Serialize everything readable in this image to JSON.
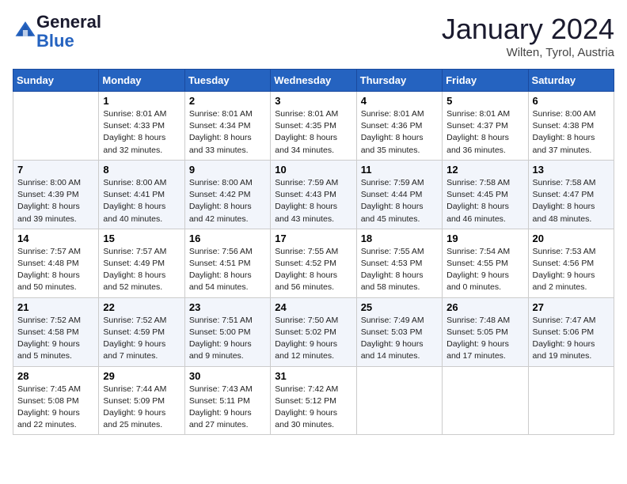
{
  "header": {
    "logo_line1": "General",
    "logo_line2": "Blue",
    "month_title": "January 2024",
    "location": "Wilten, Tyrol, Austria"
  },
  "weekdays": [
    "Sunday",
    "Monday",
    "Tuesday",
    "Wednesday",
    "Thursday",
    "Friday",
    "Saturday"
  ],
  "weeks": [
    [
      {
        "day": "",
        "sunrise": "",
        "sunset": "",
        "daylight": ""
      },
      {
        "day": "1",
        "sunrise": "Sunrise: 8:01 AM",
        "sunset": "Sunset: 4:33 PM",
        "daylight": "Daylight: 8 hours and 32 minutes."
      },
      {
        "day": "2",
        "sunrise": "Sunrise: 8:01 AM",
        "sunset": "Sunset: 4:34 PM",
        "daylight": "Daylight: 8 hours and 33 minutes."
      },
      {
        "day": "3",
        "sunrise": "Sunrise: 8:01 AM",
        "sunset": "Sunset: 4:35 PM",
        "daylight": "Daylight: 8 hours and 34 minutes."
      },
      {
        "day": "4",
        "sunrise": "Sunrise: 8:01 AM",
        "sunset": "Sunset: 4:36 PM",
        "daylight": "Daylight: 8 hours and 35 minutes."
      },
      {
        "day": "5",
        "sunrise": "Sunrise: 8:01 AM",
        "sunset": "Sunset: 4:37 PM",
        "daylight": "Daylight: 8 hours and 36 minutes."
      },
      {
        "day": "6",
        "sunrise": "Sunrise: 8:00 AM",
        "sunset": "Sunset: 4:38 PM",
        "daylight": "Daylight: 8 hours and 37 minutes."
      }
    ],
    [
      {
        "day": "7",
        "sunrise": "Sunrise: 8:00 AM",
        "sunset": "Sunset: 4:39 PM",
        "daylight": "Daylight: 8 hours and 39 minutes."
      },
      {
        "day": "8",
        "sunrise": "Sunrise: 8:00 AM",
        "sunset": "Sunset: 4:41 PM",
        "daylight": "Daylight: 8 hours and 40 minutes."
      },
      {
        "day": "9",
        "sunrise": "Sunrise: 8:00 AM",
        "sunset": "Sunset: 4:42 PM",
        "daylight": "Daylight: 8 hours and 42 minutes."
      },
      {
        "day": "10",
        "sunrise": "Sunrise: 7:59 AM",
        "sunset": "Sunset: 4:43 PM",
        "daylight": "Daylight: 8 hours and 43 minutes."
      },
      {
        "day": "11",
        "sunrise": "Sunrise: 7:59 AM",
        "sunset": "Sunset: 4:44 PM",
        "daylight": "Daylight: 8 hours and 45 minutes."
      },
      {
        "day": "12",
        "sunrise": "Sunrise: 7:58 AM",
        "sunset": "Sunset: 4:45 PM",
        "daylight": "Daylight: 8 hours and 46 minutes."
      },
      {
        "day": "13",
        "sunrise": "Sunrise: 7:58 AM",
        "sunset": "Sunset: 4:47 PM",
        "daylight": "Daylight: 8 hours and 48 minutes."
      }
    ],
    [
      {
        "day": "14",
        "sunrise": "Sunrise: 7:57 AM",
        "sunset": "Sunset: 4:48 PM",
        "daylight": "Daylight: 8 hours and 50 minutes."
      },
      {
        "day": "15",
        "sunrise": "Sunrise: 7:57 AM",
        "sunset": "Sunset: 4:49 PM",
        "daylight": "Daylight: 8 hours and 52 minutes."
      },
      {
        "day": "16",
        "sunrise": "Sunrise: 7:56 AM",
        "sunset": "Sunset: 4:51 PM",
        "daylight": "Daylight: 8 hours and 54 minutes."
      },
      {
        "day": "17",
        "sunrise": "Sunrise: 7:55 AM",
        "sunset": "Sunset: 4:52 PM",
        "daylight": "Daylight: 8 hours and 56 minutes."
      },
      {
        "day": "18",
        "sunrise": "Sunrise: 7:55 AM",
        "sunset": "Sunset: 4:53 PM",
        "daylight": "Daylight: 8 hours and 58 minutes."
      },
      {
        "day": "19",
        "sunrise": "Sunrise: 7:54 AM",
        "sunset": "Sunset: 4:55 PM",
        "daylight": "Daylight: 9 hours and 0 minutes."
      },
      {
        "day": "20",
        "sunrise": "Sunrise: 7:53 AM",
        "sunset": "Sunset: 4:56 PM",
        "daylight": "Daylight: 9 hours and 2 minutes."
      }
    ],
    [
      {
        "day": "21",
        "sunrise": "Sunrise: 7:52 AM",
        "sunset": "Sunset: 4:58 PM",
        "daylight": "Daylight: 9 hours and 5 minutes."
      },
      {
        "day": "22",
        "sunrise": "Sunrise: 7:52 AM",
        "sunset": "Sunset: 4:59 PM",
        "daylight": "Daylight: 9 hours and 7 minutes."
      },
      {
        "day": "23",
        "sunrise": "Sunrise: 7:51 AM",
        "sunset": "Sunset: 5:00 PM",
        "daylight": "Daylight: 9 hours and 9 minutes."
      },
      {
        "day": "24",
        "sunrise": "Sunrise: 7:50 AM",
        "sunset": "Sunset: 5:02 PM",
        "daylight": "Daylight: 9 hours and 12 minutes."
      },
      {
        "day": "25",
        "sunrise": "Sunrise: 7:49 AM",
        "sunset": "Sunset: 5:03 PM",
        "daylight": "Daylight: 9 hours and 14 minutes."
      },
      {
        "day": "26",
        "sunrise": "Sunrise: 7:48 AM",
        "sunset": "Sunset: 5:05 PM",
        "daylight": "Daylight: 9 hours and 17 minutes."
      },
      {
        "day": "27",
        "sunrise": "Sunrise: 7:47 AM",
        "sunset": "Sunset: 5:06 PM",
        "daylight": "Daylight: 9 hours and 19 minutes."
      }
    ],
    [
      {
        "day": "28",
        "sunrise": "Sunrise: 7:45 AM",
        "sunset": "Sunset: 5:08 PM",
        "daylight": "Daylight: 9 hours and 22 minutes."
      },
      {
        "day": "29",
        "sunrise": "Sunrise: 7:44 AM",
        "sunset": "Sunset: 5:09 PM",
        "daylight": "Daylight: 9 hours and 25 minutes."
      },
      {
        "day": "30",
        "sunrise": "Sunrise: 7:43 AM",
        "sunset": "Sunset: 5:11 PM",
        "daylight": "Daylight: 9 hours and 27 minutes."
      },
      {
        "day": "31",
        "sunrise": "Sunrise: 7:42 AM",
        "sunset": "Sunset: 5:12 PM",
        "daylight": "Daylight: 9 hours and 30 minutes."
      },
      {
        "day": "",
        "sunrise": "",
        "sunset": "",
        "daylight": ""
      },
      {
        "day": "",
        "sunrise": "",
        "sunset": "",
        "daylight": ""
      },
      {
        "day": "",
        "sunrise": "",
        "sunset": "",
        "daylight": ""
      }
    ]
  ]
}
